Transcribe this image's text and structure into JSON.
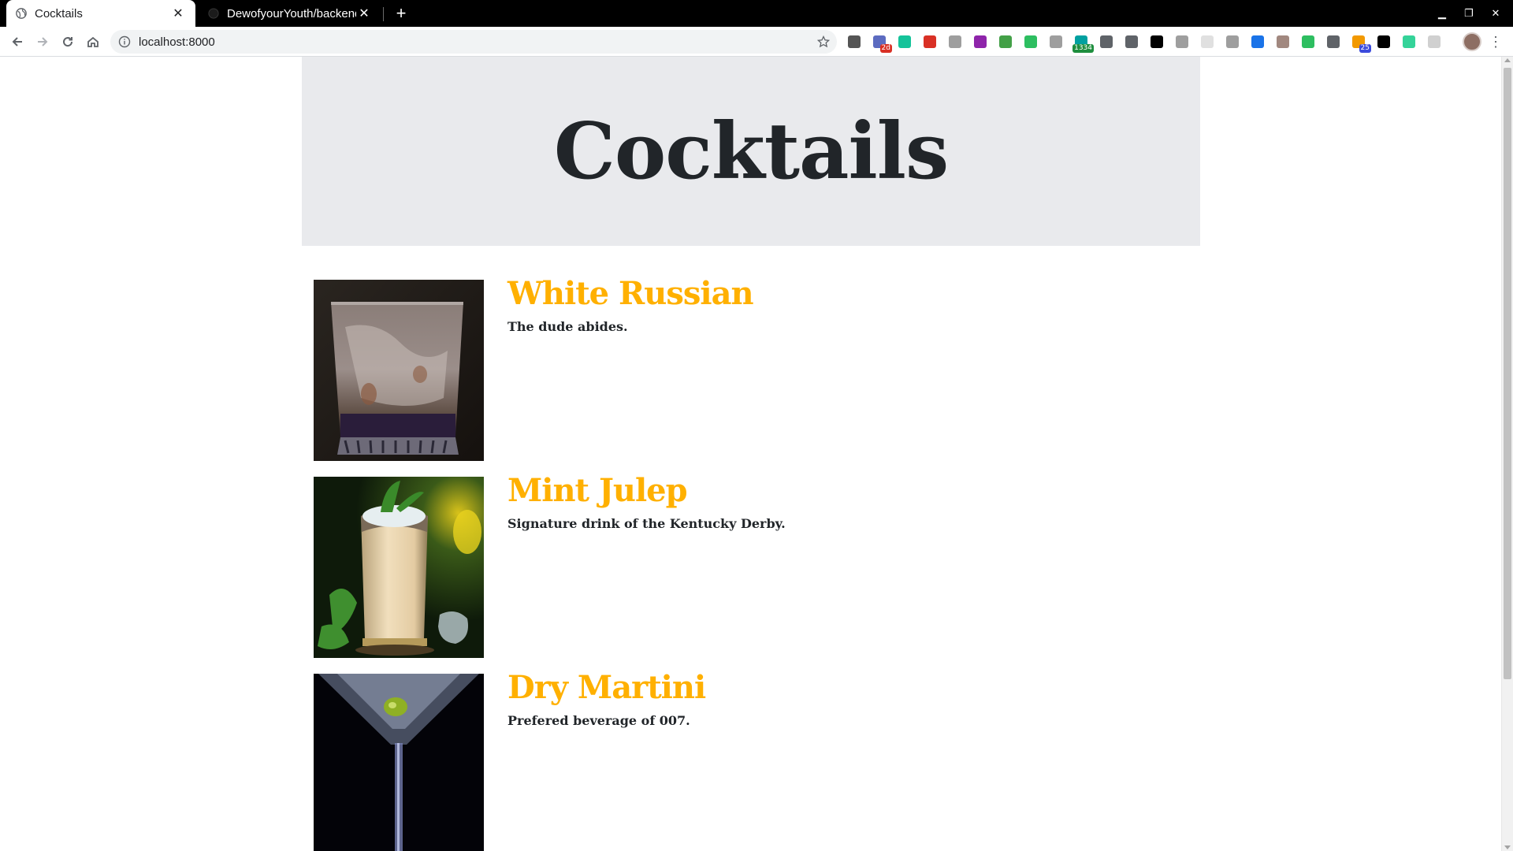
{
  "browser": {
    "tabs": [
      {
        "title": "Cocktails",
        "active": true,
        "close": "✕"
      },
      {
        "title": "DewofyourYouth/backend",
        "active": false,
        "close": "✕"
      }
    ],
    "new_tab": "+",
    "window_controls": {
      "minimize": "▁",
      "maximize": "❐",
      "close": "✕"
    },
    "url": "localhost:8000",
    "menu": "⋮",
    "extensions": [
      {
        "icon": "notion-icon",
        "color": "#555555",
        "badge": ""
      },
      {
        "icon": "calendar-icon",
        "color": "#5c6bc0",
        "badge": "2d",
        "badge_color": "#d93025"
      },
      {
        "icon": "grammarly-icon",
        "color": "#15c39a",
        "badge": ""
      },
      {
        "icon": "gmail-icon",
        "color": "#d93025",
        "badge": ""
      },
      {
        "icon": "cube-icon",
        "color": "#9e9e9e",
        "badge": ""
      },
      {
        "icon": "color-wheel-icon",
        "color": "#8e24aa",
        "badge": ""
      },
      {
        "icon": "rainbow-icon",
        "color": "#43a047",
        "badge": ""
      },
      {
        "icon": "evernote-icon",
        "color": "#2dbe60",
        "badge": ""
      },
      {
        "icon": "printer-icon",
        "color": "#9e9e9e",
        "badge": ""
      },
      {
        "icon": "counter-icon",
        "color": "#00a0a0",
        "badge": "1334",
        "badge_color": "#1e8e3e"
      },
      {
        "icon": "shield-icon",
        "color": "#5f6368",
        "badge": ""
      },
      {
        "icon": "pocket-icon",
        "color": "#5f6368",
        "badge": ""
      },
      {
        "icon": "play-icon",
        "color": "#000000",
        "badge": ""
      },
      {
        "icon": "paint-roller-icon",
        "color": "#9e9e9e",
        "badge": ""
      },
      {
        "icon": "blank-icon",
        "color": "#e0e0e0",
        "badge": ""
      },
      {
        "icon": "vue-icon",
        "color": "#9e9e9e",
        "badge": ""
      },
      {
        "icon": "pen-icon",
        "color": "#1a73e8",
        "badge": ""
      },
      {
        "icon": "cookie-icon",
        "color": "#a1887f",
        "badge": ""
      },
      {
        "icon": "chat-bubble-icon",
        "color": "#2dbe60",
        "badge": ""
      },
      {
        "icon": "moon-icon",
        "color": "#5f6368",
        "badge": ""
      },
      {
        "icon": "rss-icon",
        "color": "#f29900",
        "badge": "25",
        "badge_color": "#3c4bdc"
      },
      {
        "icon": "feather-icon",
        "color": "#000000",
        "badge": ""
      },
      {
        "icon": "waveform-icon",
        "color": "#34d399",
        "badge": ""
      },
      {
        "icon": "disabled-extension-icon",
        "color": "#d0d0d0",
        "badge": ""
      }
    ]
  },
  "page": {
    "heading": "Cocktails",
    "cocktails": [
      {
        "name": "White Russian",
        "description": "The dude abides."
      },
      {
        "name": "Mint Julep",
        "description": "Signature drink of the Kentucky Derby."
      },
      {
        "name": "Dry Martini",
        "description": "Prefered beverage of 007."
      }
    ],
    "colors": {
      "accent": "#ffb000",
      "hero_bg": "#e9eaed",
      "text": "#212529"
    }
  }
}
